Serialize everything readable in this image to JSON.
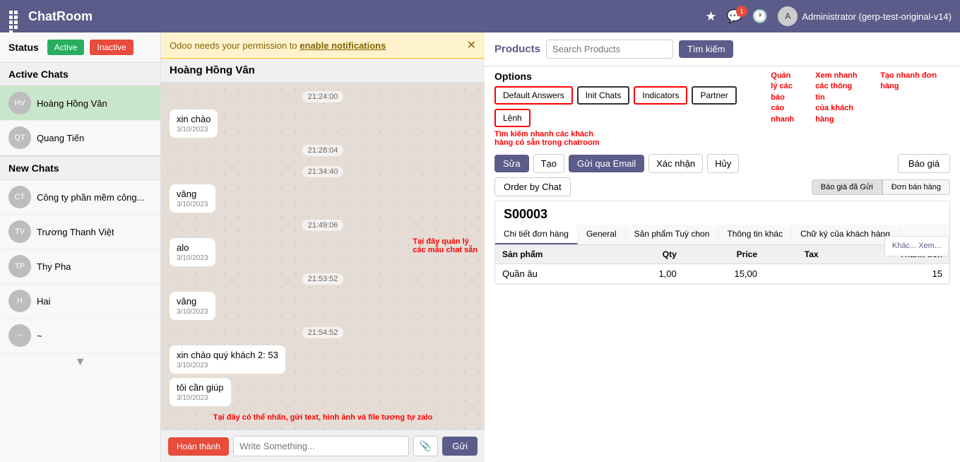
{
  "topbar": {
    "title": "ChatRoom",
    "user": "Administrator (gerp-test-original-v14)",
    "notification_count": "1"
  },
  "sidebar": {
    "status_label": "Status",
    "btn_active": "Active",
    "btn_inactive": "Inactive",
    "active_chats_title": "Active Chats",
    "new_chats_title": "New Chats",
    "active_chats": [
      {
        "name": "Hoàng Hồng Vân",
        "initials": "HV"
      },
      {
        "name": "Quang Tiến",
        "initials": "QT"
      }
    ],
    "new_chats": [
      {
        "name": "Công ty phần mềm công...",
        "initials": "CT"
      },
      {
        "name": "Trương Thanh Việt",
        "initials": "TV"
      },
      {
        "name": "Thy Pha",
        "initials": "TP"
      },
      {
        "name": "Hai",
        "initials": "H"
      },
      {
        "name": "~",
        "initials": "~"
      }
    ]
  },
  "chat": {
    "contact_name": "Hoàng Hồng Vân",
    "notification_text": "Odoo needs your permission to",
    "notification_link": "enable notifications",
    "messages": [
      {
        "type": "timestamp",
        "text": "21:24:00"
      },
      {
        "type": "received",
        "text": "xin chào",
        "meta": "3/10/2023"
      },
      {
        "type": "timestamp",
        "text": "21:28:04"
      },
      {
        "type": "timestamp",
        "text": "21:34:40"
      },
      {
        "type": "received",
        "text": "vâng",
        "meta": "3/10/2023"
      },
      {
        "type": "timestamp",
        "text": "21:49:06"
      },
      {
        "type": "received",
        "text": "alo",
        "meta": "3/10/2023"
      },
      {
        "type": "timestamp",
        "text": "21:53:52"
      },
      {
        "type": "received",
        "text": "vâng",
        "meta": "3/10/2023"
      },
      {
        "type": "timestamp",
        "text": "21:54:52"
      },
      {
        "type": "received",
        "text": "xin chào quý khách 2: 53",
        "meta": "3/10/2023"
      },
      {
        "type": "received",
        "text": "tôi cần giúp",
        "meta": "3/10/2023"
      }
    ],
    "input_placeholder": "Write Something...",
    "btn_complete": "Hoàn thành",
    "btn_send": "Gửi",
    "annotation_manage": "Tại đây quản lý\ncác mẫu chat sẵn",
    "annotation_type": "Tại đây có thể nhấn, gửi text, hình ảnh và file tương tự zalo"
  },
  "right_panel": {
    "products_label": "Products",
    "search_placeholder": "Search Products",
    "btn_search": "Tìm kiếm",
    "options_title": "Options",
    "tabs": [
      {
        "label": "Default Answers",
        "style": "red-border"
      },
      {
        "label": "Init Chats",
        "style": "black-border"
      },
      {
        "label": "Indicators",
        "style": "red-border"
      },
      {
        "label": "Partner",
        "style": "black-border"
      },
      {
        "label": "Lệnh",
        "style": "red-border"
      }
    ],
    "annotation_quan_ly": "Quản\nlý các\nbáo\ncáo\nnhanh",
    "annotation_xem_nhanh": "Xem nhanh\ncác thông tin\ncủa khách\nhàng",
    "annotation_tao_nhanh": "Tạo nhanh đơn hàng",
    "annotation_tim_kiem": "Tìm kiếm nhanh các khách\nhàng có sẵn trong chatroom",
    "btn_edit": "Sửa",
    "btn_create": "Tạo",
    "btn_email": "Gửi qua Email",
    "btn_confirm": "Xác nhận",
    "btn_cancel": "Hủy",
    "btn_quote": "Báo giá",
    "btn_order_by_chat": "Order by Chat",
    "btn_pipeline1": "Báo giá đã Gửi",
    "btn_pipeline2": "Đơn bán hàng",
    "order_id": "S00003",
    "partner_btn": "Khác...\nXem...",
    "order_tabs": [
      {
        "label": "Chi tiết đơn hàng",
        "active": true
      },
      {
        "label": "General"
      },
      {
        "label": "Sản phẩm Tuỳ chon"
      },
      {
        "label": "Thông tin khác"
      },
      {
        "label": "Chữ ký của khách hàng"
      }
    ],
    "table_headers": [
      "Sản phẩm",
      "Qty",
      "Price",
      "Tax",
      "Thành tiền"
    ],
    "table_rows": [
      {
        "product": "Quần âu",
        "qty": "1,00",
        "price": "15,00",
        "tax": "",
        "total": "15"
      }
    ]
  }
}
